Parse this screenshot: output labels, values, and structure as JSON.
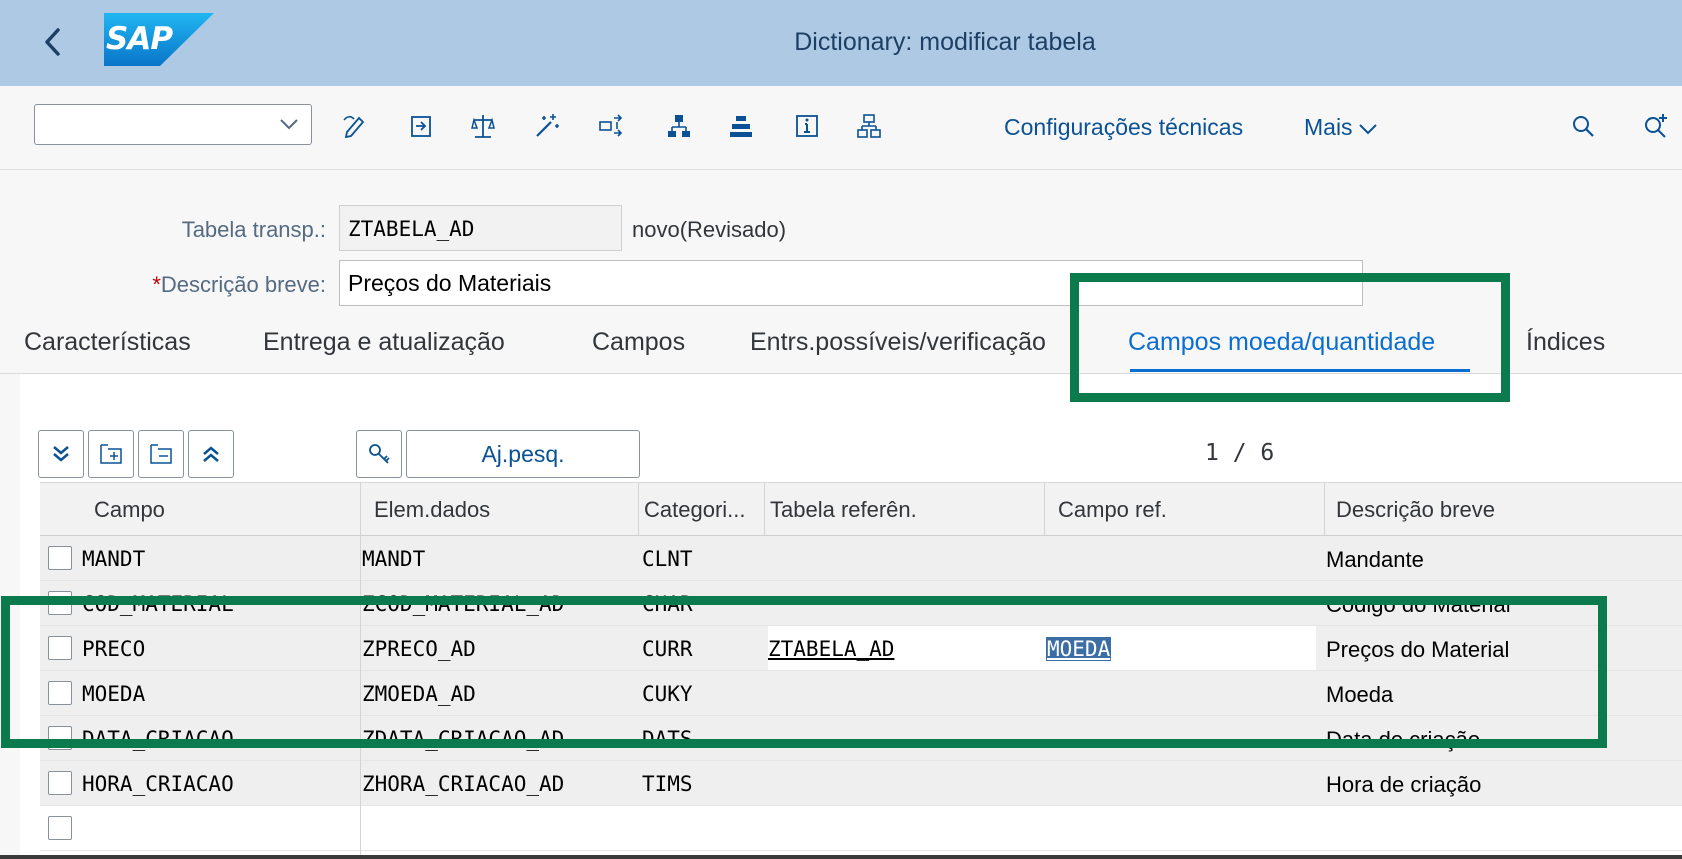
{
  "shell": {
    "title": "Dictionary: modificar tabela",
    "logo_text": "SAP",
    "header_color": "#aec9e4"
  },
  "toolbar": {
    "command_field_value": "",
    "icons": [
      "edit-pen-icon",
      "transport-icon",
      "balance-scale-icon",
      "magic-wand-icon",
      "where-used-icon",
      "hierarchy-icon",
      "upload-icon",
      "info-icon",
      "tree-structure-icon"
    ],
    "tech_settings_label": "Configurações técnicas",
    "more_label": "Mais",
    "search_icon": "search-icon",
    "search_plus_icon": "search-plus-icon"
  },
  "header": {
    "table_label": "Tabela transp.:",
    "table_value": "ZTABELA_AD",
    "status_text": "novo(Revisado)",
    "desc_required_mark": "*",
    "desc_label": "Descrição breve:",
    "desc_value": "Preços do Materiais"
  },
  "tabs": [
    {
      "label": "Características",
      "active": false
    },
    {
      "label": "Entrega e atualização",
      "active": false
    },
    {
      "label": "Campos",
      "active": false
    },
    {
      "label": "Entrs.possíveis/verificação",
      "active": false
    },
    {
      "label": "Campos moeda/quantidade",
      "active": true
    },
    {
      "label": "Índices",
      "active": false
    }
  ],
  "table_toolbar": {
    "icons": [
      "expand-all-icon",
      "insert-row-icon",
      "delete-row-icon",
      "collapse-all-icon",
      "key-icon"
    ],
    "search_help_label": "Aj.pesq.",
    "pager": "1  /  6"
  },
  "grid": {
    "columns": [
      "Campo",
      "Elem.dados",
      "Categori...",
      "Tabela referên.",
      "Campo ref.",
      "Descrição breve"
    ],
    "rows": [
      {
        "campo": "MANDT",
        "elem": "MANDT",
        "cat": "CLNT",
        "tabref": "",
        "camporef": "",
        "desc": "Mandante"
      },
      {
        "campo": "COD_MATERIAL",
        "elem": "ZCOD_MATERIAL_AD",
        "cat": "CHAR",
        "tabref": "",
        "camporef": "",
        "desc": "Codigo do Material"
      },
      {
        "campo": "PRECO",
        "elem": "ZPRECO_AD",
        "cat": "CURR",
        "tabref": "ZTABELA_AD",
        "camporef": "MOEDA",
        "desc": "Preços do Material"
      },
      {
        "campo": "MOEDA",
        "elem": "ZMOEDA_AD",
        "cat": "CUKY",
        "tabref": "",
        "camporef": "",
        "desc": "Moeda"
      },
      {
        "campo": "DATA_CRIACAO",
        "elem": "ZDATA_CRIACAO_AD",
        "cat": "DATS",
        "tabref": "",
        "camporef": "",
        "desc": "Data de criação"
      },
      {
        "campo": "HORA_CRIACAO",
        "elem": "ZHORA_CRIACAO_AD",
        "cat": "TIMS",
        "tabref": "",
        "camporef": "",
        "desc": "Hora de criação"
      },
      {
        "campo": "",
        "elem": "",
        "cat": "",
        "tabref": "",
        "camporef": "",
        "desc": ""
      }
    ]
  },
  "annotation_color": "#0b7a4d"
}
